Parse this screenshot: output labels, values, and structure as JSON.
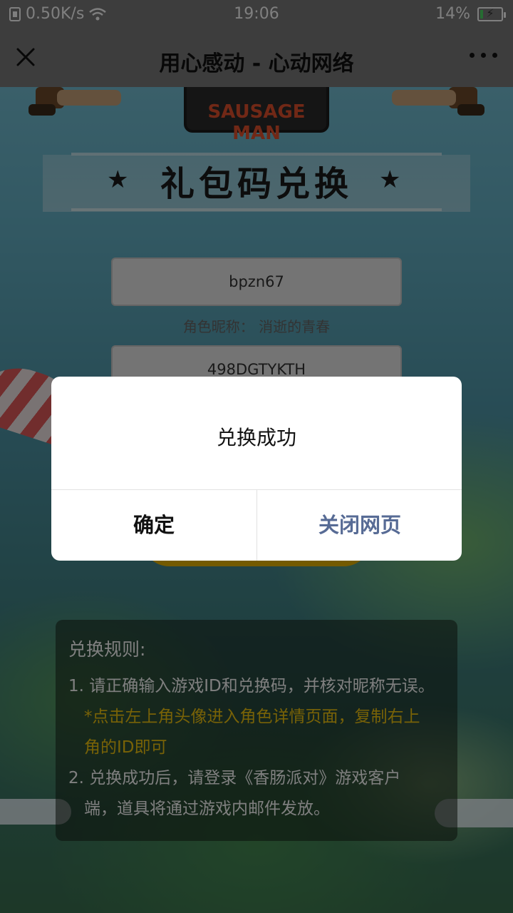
{
  "status_bar": {
    "net_speed": "0.50K/s",
    "time": "19:06",
    "battery": "14%",
    "battery_level": 0.14
  },
  "nav": {
    "title": "用心感动 - 心动网络"
  },
  "page": {
    "logo_text": "SAUSAGE MAN",
    "title": "礼包码兑换",
    "game_id_value": "bpzn67",
    "nickname_label": "角色昵称：",
    "nickname_value": "消逝的青春",
    "code_value": "498DGTYKTH",
    "rules": {
      "title": "兑换规则:",
      "line1": "1. 请正确输入游戏ID和兑换码，并核对昵称无误。",
      "hint_line1": "*点击左上角头像进入角色详情页面，复制右上",
      "hint_line2": "角的ID即可",
      "line2a": "2. 兑换成功后，请登录《香肠派对》游戏客户",
      "line2b": "端，道具将通过游戏内邮件发放。"
    }
  },
  "dialog": {
    "message": "兑换成功",
    "confirm_label": "确定",
    "close_label": "关闭网页"
  },
  "colors": {
    "dialog_link": "#576b95",
    "hint": "#f1c40f",
    "submit": "#e8b400"
  }
}
